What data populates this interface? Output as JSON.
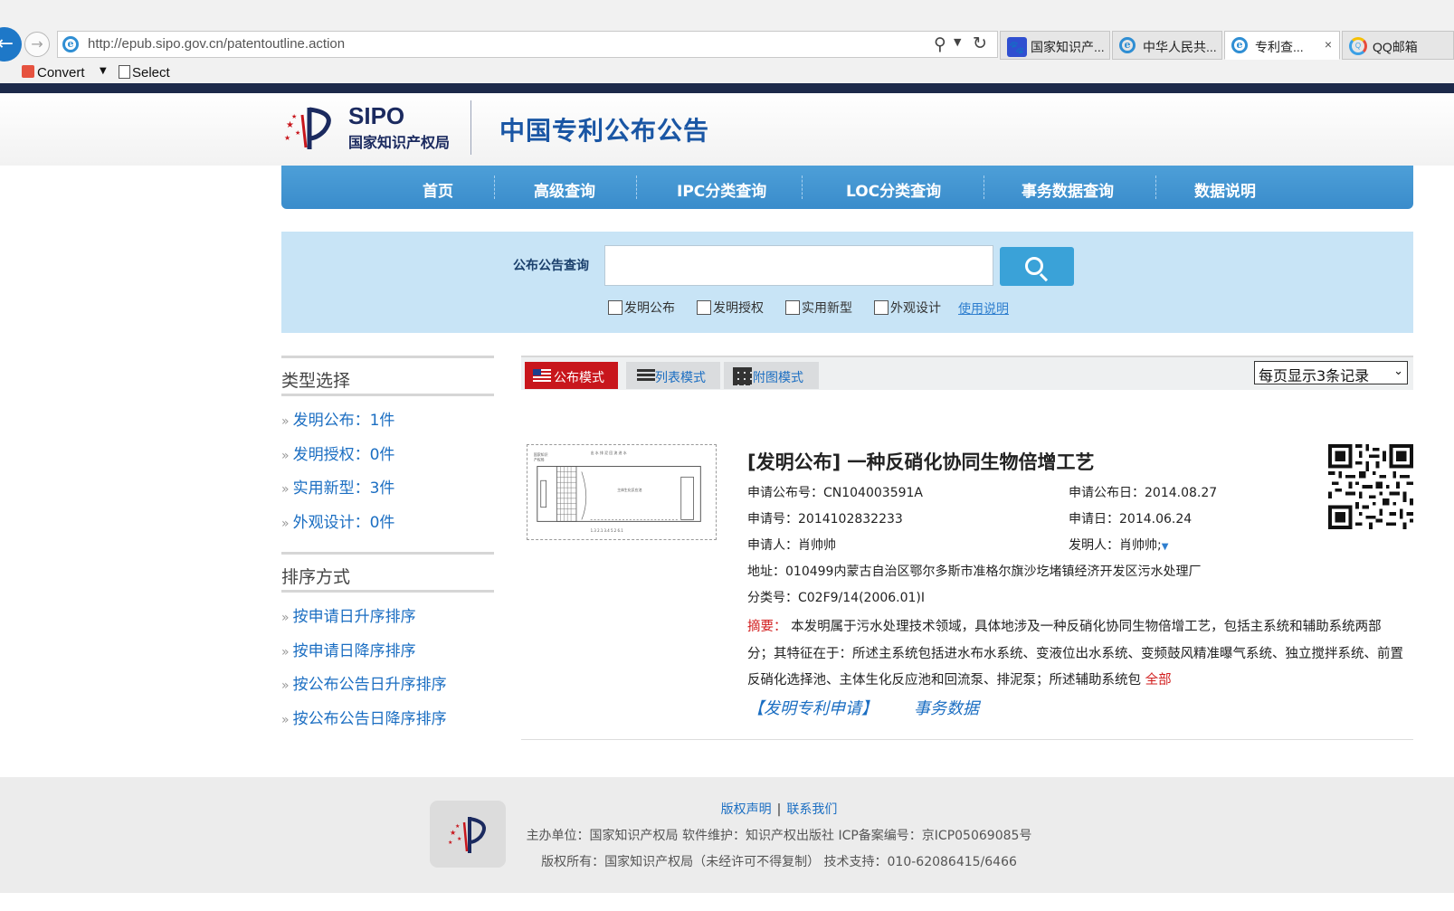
{
  "browser": {
    "url": "http://epub.sipo.gov.cn/patentoutline.action",
    "tabs": [
      {
        "label": "国家知识产...",
        "icon": "baidu-paw-icon",
        "active": false
      },
      {
        "label": "中华人民共...",
        "icon": "ie-icon",
        "active": false
      },
      {
        "label": "专利查...",
        "icon": "ie-icon",
        "active": true
      },
      {
        "label": "QQ邮箱",
        "icon": "qq-icon",
        "active": false
      }
    ],
    "tab_close": "×",
    "command_bar": {
      "convert": "Convert",
      "select": "Select"
    }
  },
  "header": {
    "logo_text": "SIPO",
    "logo_cn": "国家知识产权局",
    "title": "中国专利公布公告"
  },
  "nav": {
    "items": [
      "首页",
      "高级查询",
      "IPC分类查询",
      "LOC分类查询",
      "事务数据查询",
      "数据说明"
    ]
  },
  "search": {
    "label": "公布公告查询",
    "value": "",
    "options": [
      {
        "label": "发明公布",
        "checked": false
      },
      {
        "label": "发明授权",
        "checked": false
      },
      {
        "label": "实用新型",
        "checked": false
      },
      {
        "label": "外观设计",
        "checked": false
      }
    ],
    "help_link": "使用说明"
  },
  "sidebar": {
    "type_heading": "类型选择",
    "types": [
      "发明公布：1件",
      "发明授权：0件",
      "实用新型：3件",
      "外观设计：0件"
    ],
    "sort_heading": "排序方式",
    "sorts": [
      "按申请日升序排序",
      "按申请日降序排序",
      "按公布公告日升序排序",
      "按公布公告日降序排序"
    ],
    "bullet": "»"
  },
  "results": {
    "modes": [
      "公布模式",
      "列表模式",
      "附图模式"
    ],
    "active_mode": "公布模式",
    "per_page": "每页显示3条记录",
    "item": {
      "title": "[发明公布] 一种反硝化协同生物倍增工艺",
      "pub_no": "申请公布号：CN104003591A",
      "pub_date": "申请公布日：2014.08.27",
      "app_no": "申请号：2014102832233",
      "app_date": "申请日：2014.06.24",
      "applicant": "申请人：肖帅帅",
      "inventor": "发明人：肖帅帅;",
      "address": "地址：010499内蒙古自治区鄂尔多斯市准格尔旗沙圪堵镇经济开发区污水处理厂",
      "classification": "分类号：C02F9/14(2006.01)I",
      "abstract_label": "摘要：",
      "abstract": "本发明属于污水处理技术领域，具体地涉及一种反硝化协同生物倍增工艺，包括主系统和辅助系统两部分；其特征在于：所述主系统包括进水布水系统、变液位出水系统、变频鼓风精准曝气系统、独立搅拌系统、前置反硝化选择池、主体生化反应池和回流泵、排泥泵；所述辅助系统包",
      "more": "全部",
      "link_application": "【发明专利申请】",
      "link_affairs": "事务数据"
    }
  },
  "footer": {
    "link_copyright": "版权声明",
    "link_contact": "联系我们",
    "link_sep": "|",
    "line1": "主办单位：国家知识产权局 软件维护：知识产权出版社 ICP备案编号：京ICP05069085号",
    "line2": "版权所有：国家知识产权局（未经许可不得复制） 技术支持：010-62086415/6466"
  },
  "colors": {
    "nav_blue": "#3a8ccb",
    "search_panel": "#c8e4f6",
    "link_blue": "#1b6ec2",
    "accent_red": "#c8161c",
    "title_blue": "#1a56a4"
  }
}
